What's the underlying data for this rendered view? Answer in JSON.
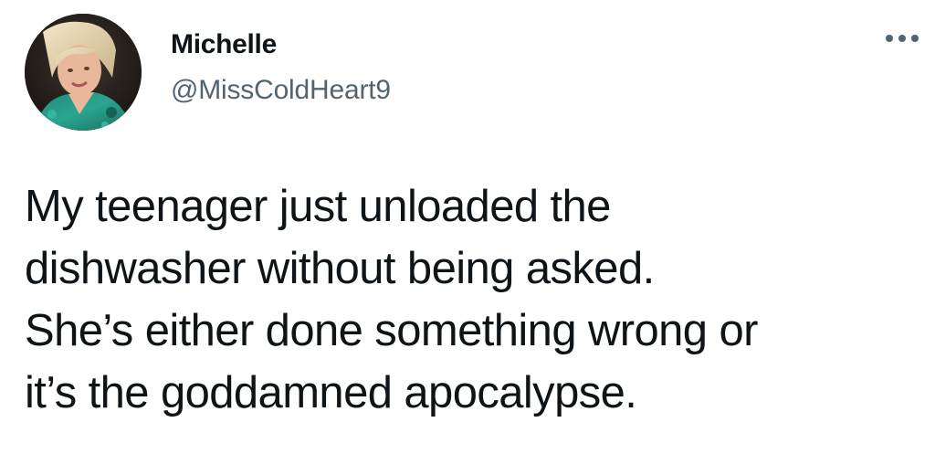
{
  "author": {
    "display_name": "Michelle",
    "handle": "@MissColdHeart9",
    "avatar_icon": "profile-photo"
  },
  "menu": {
    "icon": "more-horizontal-icon"
  },
  "tweet": {
    "lines": [
      "My teenager just unloaded the",
      "dishwasher without being asked.",
      "She’s either done something wrong or",
      "it’s the goddamned apocalypse."
    ]
  },
  "colors": {
    "text": "#0f1419",
    "secondary": "#536471",
    "background": "#ffffff"
  }
}
